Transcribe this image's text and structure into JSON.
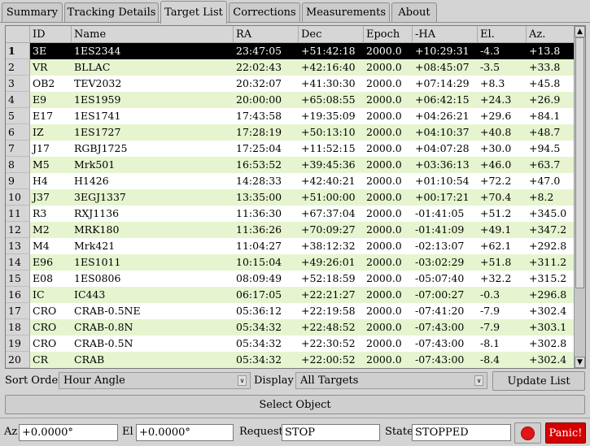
{
  "tabs": [
    {
      "label": "Summary",
      "active": false
    },
    {
      "label": "Tracking Details",
      "active": false
    },
    {
      "label": "Target List",
      "active": true
    },
    {
      "label": "Corrections",
      "active": false
    },
    {
      "label": "Measurements",
      "active": false
    },
    {
      "label": "About",
      "active": false
    }
  ],
  "table": {
    "columns": [
      "ID",
      "Name",
      "RA",
      "Dec",
      "Epoch",
      "-HA",
      "El.",
      "Az."
    ],
    "selected_row": 1,
    "rows": [
      {
        "n": "1",
        "cells": [
          "3E",
          "1ES2344",
          "23:47:05",
          "+51:42:18",
          "2000.0",
          "+10:29:31",
          "-4.3",
          "+13.8"
        ]
      },
      {
        "n": "2",
        "cells": [
          "VR",
          "BLLAC",
          "22:02:43",
          "+42:16:40",
          "2000.0",
          "+08:45:07",
          "-3.5",
          "+33.8"
        ]
      },
      {
        "n": "3",
        "cells": [
          "OB2",
          "TEV2032",
          "20:32:07",
          "+41:30:30",
          "2000.0",
          "+07:14:29",
          "+8.3",
          "+45.8"
        ]
      },
      {
        "n": "4",
        "cells": [
          "E9",
          "1ES1959",
          "20:00:00",
          "+65:08:55",
          "2000.0",
          "+06:42:15",
          "+24.3",
          "+26.9"
        ]
      },
      {
        "n": "5",
        "cells": [
          "E17",
          "1ES1741",
          "17:43:58",
          "+19:35:09",
          "2000.0",
          "+04:26:21",
          "+29.6",
          "+84.1"
        ]
      },
      {
        "n": "6",
        "cells": [
          "IZ",
          "1ES1727",
          "17:28:19",
          "+50:13:10",
          "2000.0",
          "+04:10:37",
          "+40.8",
          "+48.7"
        ]
      },
      {
        "n": "7",
        "cells": [
          "J17",
          "RGBJ1725",
          "17:25:04",
          "+11:52:15",
          "2000.0",
          "+04:07:28",
          "+30.0",
          "+94.5"
        ]
      },
      {
        "n": "8",
        "cells": [
          "M5",
          "Mrk501",
          "16:53:52",
          "+39:45:36",
          "2000.0",
          "+03:36:13",
          "+46.0",
          "+63.7"
        ]
      },
      {
        "n": "9",
        "cells": [
          "H4",
          "H1426",
          "14:28:33",
          "+42:40:21",
          "2000.0",
          "+01:10:54",
          "+72.2",
          "+47.0"
        ]
      },
      {
        "n": "10",
        "cells": [
          "J37",
          "3EGJ1337",
          "13:35:00",
          "+51:00:00",
          "2000.0",
          "+00:17:21",
          "+70.4",
          "+8.2"
        ]
      },
      {
        "n": "11",
        "cells": [
          "R3",
          "RXJ1136",
          "11:36:30",
          "+67:37:04",
          "2000.0",
          "-01:41:05",
          "+51.2",
          "+345.0"
        ]
      },
      {
        "n": "12",
        "cells": [
          "M2",
          "MRK180",
          "11:36:26",
          "+70:09:27",
          "2000.0",
          "-01:41:09",
          "+49.1",
          "+347.2"
        ]
      },
      {
        "n": "13",
        "cells": [
          "M4",
          "Mrk421",
          "11:04:27",
          "+38:12:32",
          "2000.0",
          "-02:13:07",
          "+62.1",
          "+292.8"
        ]
      },
      {
        "n": "14",
        "cells": [
          "E96",
          "1ES1011",
          "10:15:04",
          "+49:26:01",
          "2000.0",
          "-03:02:29",
          "+51.8",
          "+311.2"
        ]
      },
      {
        "n": "15",
        "cells": [
          "E08",
          "1ES0806",
          "08:09:49",
          "+52:18:59",
          "2000.0",
          "-05:07:40",
          "+32.2",
          "+315.2"
        ]
      },
      {
        "n": "16",
        "cells": [
          "IC",
          "IC443",
          "06:17:05",
          "+22:21:27",
          "2000.0",
          "-07:00:27",
          "-0.3",
          "+296.8"
        ]
      },
      {
        "n": "17",
        "cells": [
          "CRO",
          "CRAB-0.5NE",
          "05:36:12",
          "+22:19:58",
          "2000.0",
          "-07:41:20",
          "-7.9",
          "+302.4"
        ]
      },
      {
        "n": "18",
        "cells": [
          "CRO",
          "CRAB-0.8N",
          "05:34:32",
          "+22:48:52",
          "2000.0",
          "-07:43:00",
          "-7.9",
          "+303.1"
        ]
      },
      {
        "n": "19",
        "cells": [
          "CRO",
          "CRAB-0.5N",
          "05:34:32",
          "+22:30:52",
          "2000.0",
          "-07:43:00",
          "-8.1",
          "+302.8"
        ]
      },
      {
        "n": "20",
        "cells": [
          "CR",
          "CRAB",
          "05:34:32",
          "+22:00:52",
          "2000.0",
          "-07:43:00",
          "-8.4",
          "+302.4"
        ]
      }
    ]
  },
  "scrollbar": {
    "up_icon": "▲",
    "down_icon": "▼",
    "position_fraction": 0.0
  },
  "controls": {
    "sort_order_label": "Sort Order",
    "sort_order_value": "Hour Angle",
    "display_label": "Display",
    "display_value": "All Targets",
    "update_list_label": "Update List",
    "select_object_label": "Select Object",
    "dropdown_icon": "∨"
  },
  "status": {
    "az_label": "Az",
    "az_value": "+0.0000°",
    "el_label": "El",
    "el_value": "+0.0000°",
    "request_label": "Request",
    "request_value": "STOP",
    "state_label": "State",
    "state_value": "STOPPED",
    "panic_label": "Panic!",
    "colors": {
      "row_even": "#e6f5d0",
      "selected": "#000000",
      "panic": "#d40000",
      "record": "#e01616"
    }
  }
}
